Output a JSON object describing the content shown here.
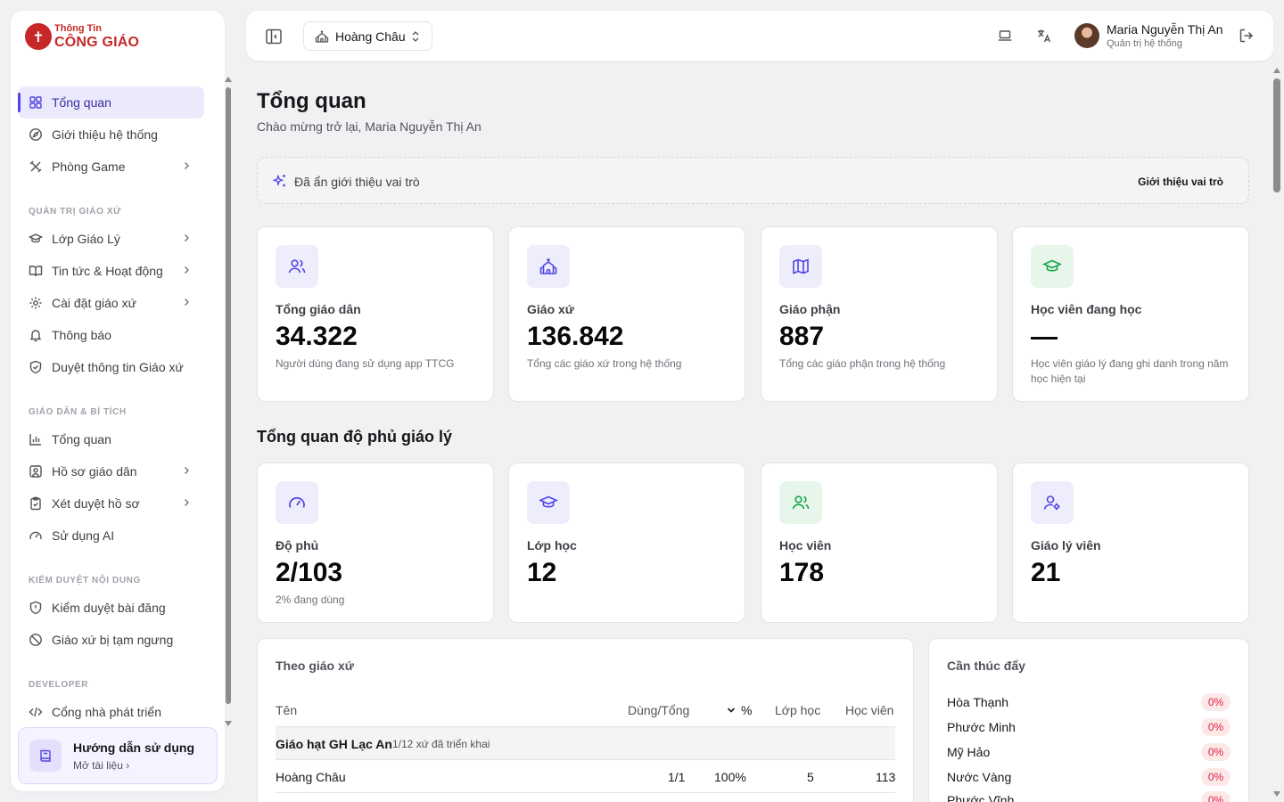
{
  "brand": {
    "top": "Thông Tin",
    "bottom": "CÔNG GIÁO"
  },
  "sidebar": {
    "items_top": [
      {
        "label": "Tổng quan",
        "icon": "grid-icon",
        "active": true
      },
      {
        "label": "Giới thiệu hệ thống",
        "icon": "compass-icon"
      },
      {
        "label": "Phòng Game",
        "icon": "game-icon",
        "has_chevron": true
      }
    ],
    "sections": [
      {
        "title": "QUẢN TRỊ GIÁO XỨ",
        "items": [
          {
            "label": "Lớp Giáo Lý",
            "icon": "graduation-cap-icon",
            "has_chevron": true
          },
          {
            "label": "Tin tức & Hoạt động",
            "icon": "book-open-icon",
            "has_chevron": true
          },
          {
            "label": "Cài đặt giáo xứ",
            "icon": "settings-icon",
            "has_chevron": true
          },
          {
            "label": "Thông báo",
            "icon": "bell-icon"
          },
          {
            "label": "Duyệt thông tin Giáo xứ",
            "icon": "shield-check-icon"
          }
        ]
      },
      {
        "title": "GIÁO DÂN & BÍ TÍCH",
        "items": [
          {
            "label": "Tổng quan",
            "icon": "bar-chart-icon"
          },
          {
            "label": "Hồ sơ giáo dân",
            "icon": "user-square-icon",
            "has_chevron": true
          },
          {
            "label": "Xét duyệt hồ sơ",
            "icon": "clipboard-check-icon",
            "has_chevron": true
          },
          {
            "label": "Sử dụng AI",
            "icon": "gauge-icon"
          }
        ]
      },
      {
        "title": "KIỂM DUYỆT NỘI DUNG",
        "items": [
          {
            "label": "Kiểm duyệt bài đăng",
            "icon": "shield-alert-icon"
          },
          {
            "label": "Giáo xứ bị tạm ngưng",
            "icon": "ban-icon"
          }
        ]
      },
      {
        "title": "DEVELOPER",
        "items": [
          {
            "label": "Cổng nhà phát triển",
            "icon": "code-icon"
          }
        ]
      }
    ],
    "guide": {
      "title": "Hướng dẫn sử dụng",
      "subtitle": "Mở tài liệu"
    }
  },
  "header": {
    "parish": "Hoàng Châu",
    "user_name": "Maria Nguyễn Thị An",
    "user_role": "Quản trị hệ thống"
  },
  "page": {
    "title": "Tổng quan",
    "subtitle": "Chào mừng trở lại, Maria Nguyễn Thị An",
    "role_notice": "Đã ẩn giới thiệu vai trò",
    "role_link": "Giới thiệu vai trò"
  },
  "stats": [
    {
      "label": "Tổng giáo dân",
      "value": "34.322",
      "desc": "Người dùng đang sử dụng app TTCG",
      "icon": "users-icon",
      "color": "#4f46e5",
      "bg": "#eeedfb"
    },
    {
      "label": "Giáo xứ",
      "value": "136.842",
      "desc": "Tổng các giáo xứ trong hệ thống",
      "icon": "church-icon",
      "color": "#4f46e5",
      "bg": "#eeedfb"
    },
    {
      "label": "Giáo phận",
      "value": "887",
      "desc": "Tổng các giáo phận trong hệ thống",
      "icon": "map-icon",
      "color": "#4f46e5",
      "bg": "#eeedfb"
    },
    {
      "label": "Học viên đang học",
      "value": "",
      "desc": "Học viên giáo lý đang ghi danh trong năm học hiện tại",
      "icon": "graduation-cap-icon",
      "color": "#16a34a",
      "bg": "#e7f6ea"
    }
  ],
  "coverage": {
    "title": "Tổng quan độ phủ giáo lý",
    "cards": [
      {
        "label": "Độ phủ",
        "value": "2/103",
        "desc": "2% đang dùng",
        "icon": "gauge-icon",
        "color": "#4f46e5",
        "bg": "#eeedfb"
      },
      {
        "label": "Lớp học",
        "value": "12",
        "desc": "",
        "icon": "graduation-cap-icon",
        "color": "#4f46e5",
        "bg": "#eeedfb"
      },
      {
        "label": "Học viên",
        "value": "178",
        "desc": "",
        "icon": "users-icon",
        "color": "#16a34a",
        "bg": "#e7f6ea"
      },
      {
        "label": "Giáo lý viên",
        "value": "21",
        "desc": "",
        "icon": "user-cog-icon",
        "color": "#4f46e5",
        "bg": "#eeedfb"
      }
    ]
  },
  "by_parish": {
    "title": "Theo giáo xứ",
    "columns": {
      "name": "Tên",
      "used": "Dùng/Tổng",
      "pct": "%",
      "classes": "Lớp học",
      "students": "Học viên"
    },
    "group": {
      "name": "Giáo hạt GH Lạc An",
      "meta": "1/12 xứ đã triển khai"
    },
    "rows": [
      {
        "name": "Hoàng Châu",
        "used": "1/1",
        "pct": "100%",
        "classes": "5",
        "students": "113"
      }
    ]
  },
  "push": {
    "title": "Cần thúc đẩy",
    "items": [
      {
        "name": "Hòa Thạnh",
        "pct": "0%"
      },
      {
        "name": "Phước Minh",
        "pct": "0%"
      },
      {
        "name": "Mỹ Hảo",
        "pct": "0%"
      },
      {
        "name": "Nước Vàng",
        "pct": "0%"
      },
      {
        "name": "Phước Vĩnh",
        "pct": "0%"
      }
    ]
  },
  "colors": {
    "accent": "#4f46e5",
    "brand": "#c62828",
    "danger": "#e11d48"
  }
}
